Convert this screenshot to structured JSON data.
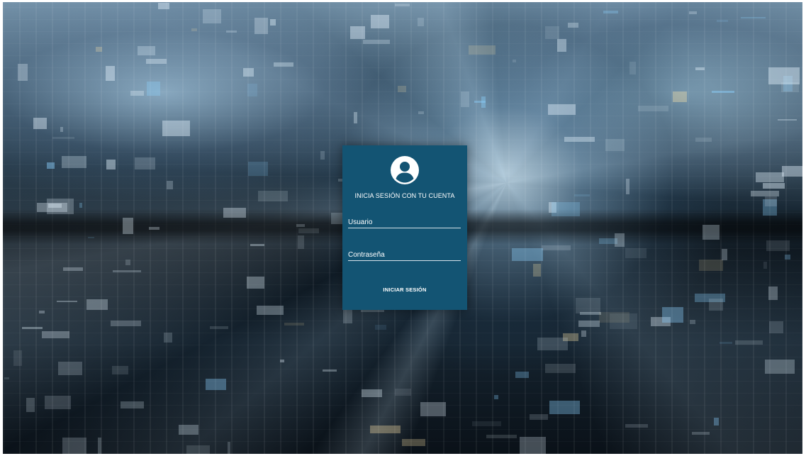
{
  "login": {
    "title": "INICIA SESIÓN CON TU CUENTA",
    "avatar_icon": "user-circle-icon",
    "username": {
      "placeholder": "Usuario",
      "value": ""
    },
    "password": {
      "placeholder": "Contraseña",
      "value": ""
    },
    "submit_label": "INICIAR SESIÓN"
  },
  "colors": {
    "card_background": "#135473",
    "text": "#ffffff",
    "field_underline": "#d7e3ea"
  }
}
